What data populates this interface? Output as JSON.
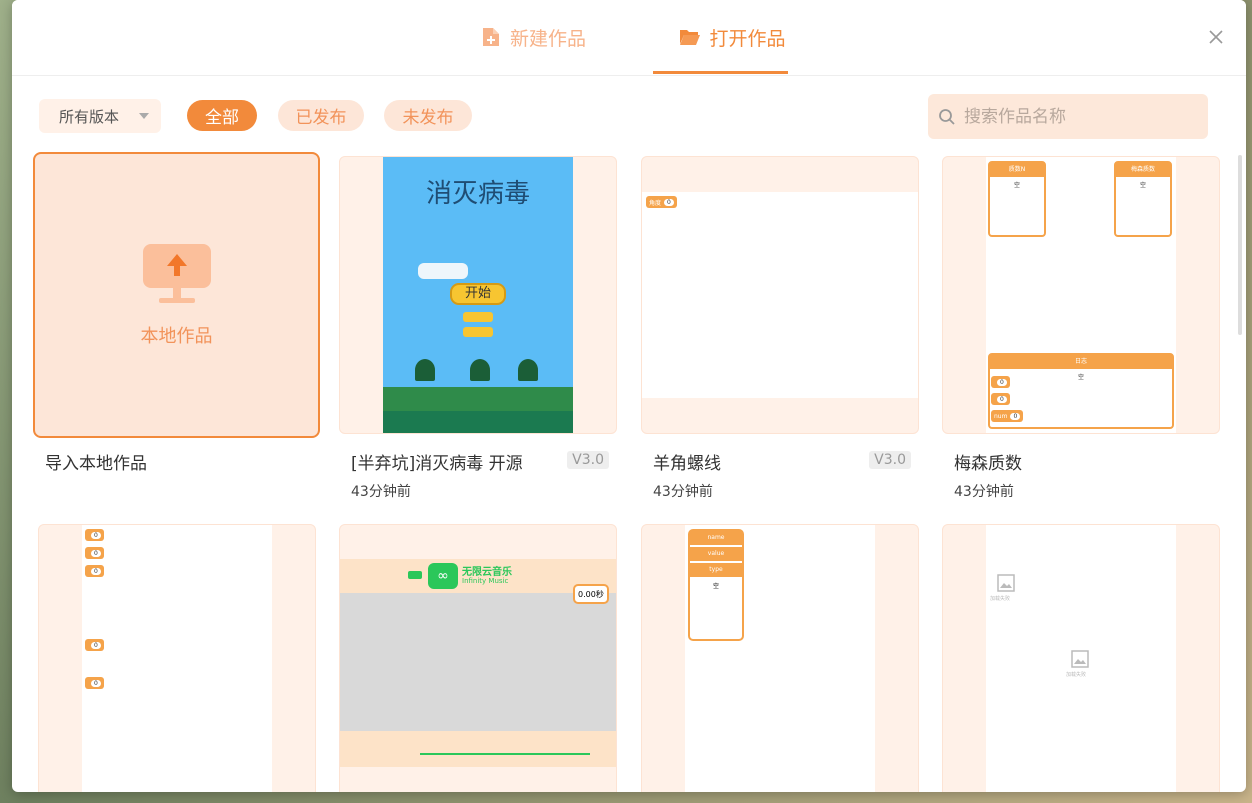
{
  "header": {
    "tabs": [
      {
        "label": "新建作品",
        "icon": "file-plus-icon",
        "active": false
      },
      {
        "label": "打开作品",
        "icon": "folder-open-icon",
        "active": true
      }
    ]
  },
  "toolbar": {
    "version_select": "所有版本",
    "filters": [
      "全部",
      "已发布",
      "未发布"
    ],
    "active_filter": "全部",
    "search_placeholder": "搜索作品名称"
  },
  "import_card": {
    "inner_label": "本地作品",
    "title": "导入本地作品",
    "icon": "upload-monitor-icon"
  },
  "cards": [
    {
      "title": "[半弃坑]消灭病毒 开源",
      "time": "43分钟前",
      "version": "V3.0",
      "preview": {
        "game_title": "消灭病毒",
        "start_button": "开始"
      }
    },
    {
      "title": "羊角螺线",
      "time": "43分钟前",
      "version": "V3.0",
      "preview": {
        "var_label": "角度",
        "var_value": "0"
      }
    },
    {
      "title": "梅森质数",
      "time": "43分钟前",
      "version": "",
      "preview": {
        "list_a": "质数N",
        "list_b": "梅森质数",
        "list_c": "日志",
        "empty": "空",
        "vars": [
          "0",
          "0",
          "0"
        ],
        "var_name": "num"
      }
    },
    {
      "title": "",
      "time": "",
      "version": "",
      "preview": {
        "vars": [
          "0",
          "0",
          "0",
          "0",
          "0"
        ]
      }
    },
    {
      "title": "",
      "time": "",
      "version": "",
      "preview": {
        "app_name": "无限云音乐",
        "app_sub": "Infinity Music",
        "timer": "0.00秒"
      }
    },
    {
      "title": "",
      "time": "",
      "version": "",
      "preview": {
        "rows": [
          "name",
          "value",
          "type"
        ],
        "empty": "空"
      }
    },
    {
      "title": "",
      "time": "",
      "version": "",
      "preview": {
        "loading_a": "加载失败",
        "loading_b": "加载失败"
      }
    }
  ],
  "colors": {
    "accent": "#f28a3b",
    "accent_light": "#fde6d8",
    "card_bg": "#fff1e8",
    "game_sky": "#5bbcf6"
  }
}
